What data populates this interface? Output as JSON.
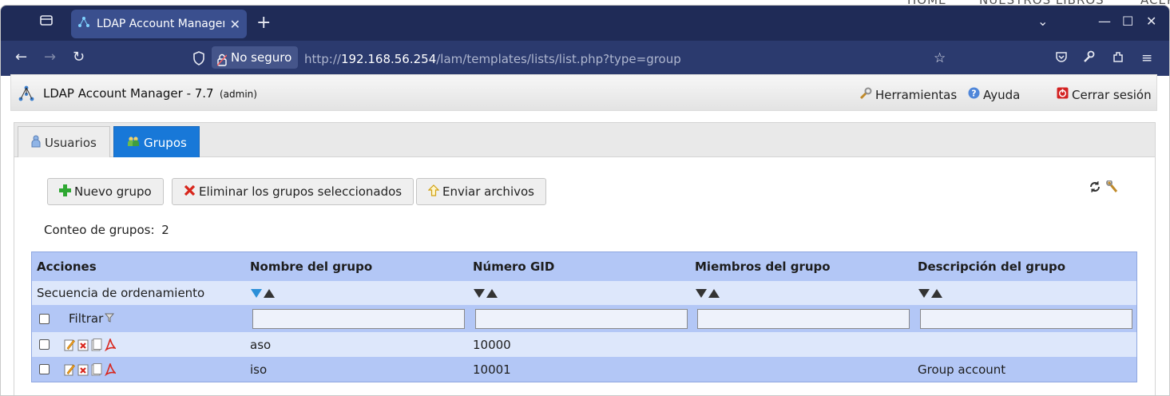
{
  "browser": {
    "background_text": [
      "HOME",
      "NUESTROS LIBROS",
      "ACER"
    ],
    "tab_title": "LDAP Account Manager (",
    "security_label": "No seguro",
    "url_prefix": "http://",
    "url_host": "192.168.56.254",
    "url_path": "/lam/templates/lists/list.php?type=group"
  },
  "app": {
    "title": "LDAP Account Manager - 7.7",
    "user": "(admin)",
    "tools_label": "Herramientas",
    "help_label": "Ayuda",
    "logout_label": "Cerrar sesión"
  },
  "tabs": [
    {
      "label": "Usuarios",
      "active": false
    },
    {
      "label": "Grupos",
      "active": true
    }
  ],
  "toolbar": {
    "new_label": "Nuevo grupo",
    "delete_label": "Eliminar los grupos seleccionados",
    "upload_label": "Enviar archivos"
  },
  "count": {
    "label": "Conteo de grupos:",
    "value": "2"
  },
  "table": {
    "headers": [
      "Acciones",
      "Nombre del grupo",
      "Número GID",
      "Miembros del grupo",
      "Descripción del grupo"
    ],
    "sort_label": "Secuencia de ordenamiento",
    "filter_label": "Filtrar",
    "rows": [
      {
        "name": "aso",
        "gid": "10000",
        "members": "",
        "description": ""
      },
      {
        "name": "iso",
        "gid": "10001",
        "members": "",
        "description": "Group account"
      }
    ]
  },
  "colors": {
    "active_tab": "#1878d8",
    "table_header": "#b3c7f6",
    "table_row_light": "#dde7fb",
    "sort_active": "#2b8fd8"
  }
}
